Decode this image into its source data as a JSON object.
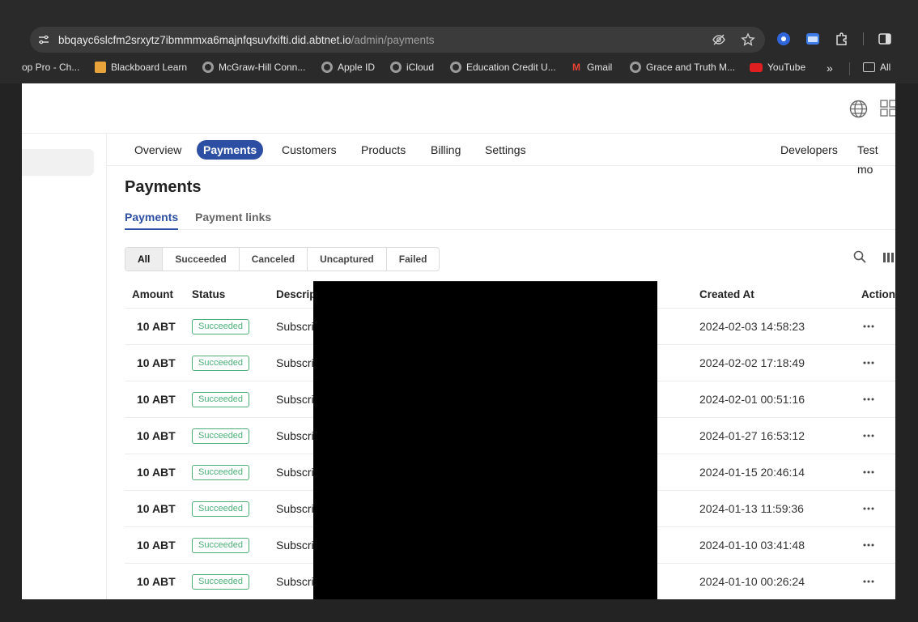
{
  "browser": {
    "url_host": "bbqayc6slcfm2srxytz7ibmmmxa6majnfqsuvfxifti.did.abtnet.io",
    "url_path": "/admin/payments",
    "bookmarks": [
      {
        "label": "op Pro - Ch...",
        "icon": "none"
      },
      {
        "label": "Blackboard Learn",
        "icon": "blackboard-icon"
      },
      {
        "label": "McGraw-Hill Conn...",
        "icon": "globe-icon"
      },
      {
        "label": "Apple ID",
        "icon": "globe-icon"
      },
      {
        "label": "iCloud",
        "icon": "globe-icon"
      },
      {
        "label": "Education Credit U...",
        "icon": "globe-icon"
      },
      {
        "label": "Gmail",
        "icon": "gmail-icon"
      },
      {
        "label": "Grace and Truth M...",
        "icon": "globe-icon"
      },
      {
        "label": "YouTube",
        "icon": "youtube-icon"
      },
      {
        "label": "All",
        "icon": "folder-icon"
      }
    ],
    "more_glyph": "»"
  },
  "nav": {
    "tabs": [
      "Overview",
      "Payments",
      "Customers",
      "Products",
      "Billing",
      "Settings"
    ],
    "right": [
      "Developers",
      "Test mo"
    ]
  },
  "page": {
    "title": "Payments",
    "subtabs": [
      "Payments",
      "Payment links"
    ],
    "filters": [
      "All",
      "Succeeded",
      "Canceled",
      "Uncaptured",
      "Failed"
    ]
  },
  "table": {
    "headers": {
      "amount": "Amount",
      "status": "Status",
      "description": "Descrip",
      "created": "Created At",
      "actions": "Action"
    },
    "rows": [
      {
        "amount": "10 ABT",
        "status": "Succeeded",
        "description": "Subscri",
        "created": "2024-02-03 14:58:23"
      },
      {
        "amount": "10 ABT",
        "status": "Succeeded",
        "description": "Subscri",
        "created": "2024-02-02 17:18:49"
      },
      {
        "amount": "10 ABT",
        "status": "Succeeded",
        "description": "Subscri",
        "created": "2024-02-01 00:51:16"
      },
      {
        "amount": "10 ABT",
        "status": "Succeeded",
        "description": "Subscri",
        "created": "2024-01-27 16:53:12"
      },
      {
        "amount": "10 ABT",
        "status": "Succeeded",
        "description": "Subscri",
        "created": "2024-01-15 20:46:14"
      },
      {
        "amount": "10 ABT",
        "status": "Succeeded",
        "description": "Subscri",
        "created": "2024-01-13 11:59:36"
      },
      {
        "amount": "10 ABT",
        "status": "Succeeded",
        "description": "Subscri",
        "created": "2024-01-10 03:41:48"
      },
      {
        "amount": "10 ABT",
        "status": "Succeeded",
        "description": "Subscri",
        "created": "2024-01-10 00:26:24"
      }
    ]
  },
  "colors": {
    "accent": "#2d4fa3",
    "success": "#4caf78"
  }
}
